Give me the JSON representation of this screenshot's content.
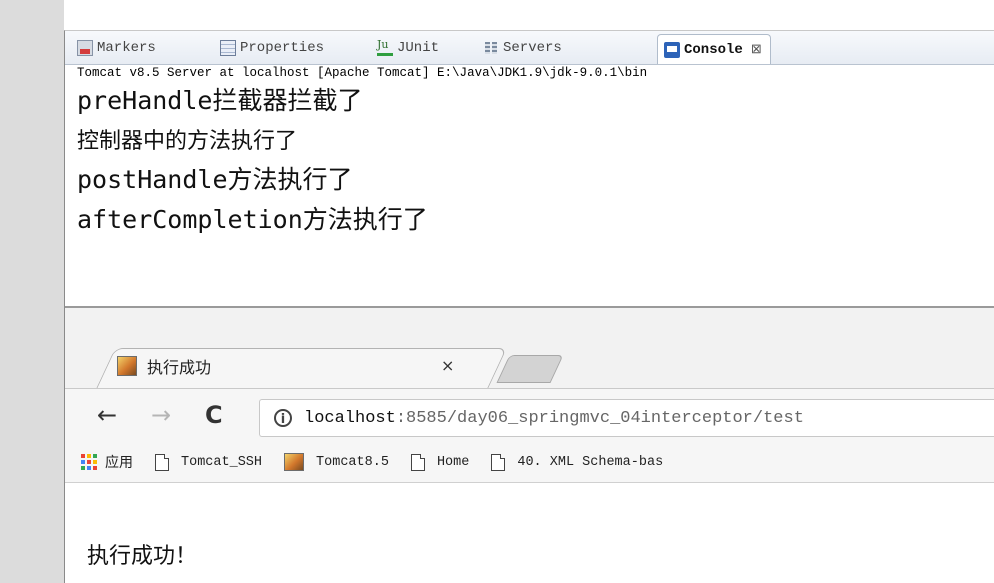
{
  "eclipse": {
    "tabs": [
      {
        "label": "Markers",
        "icon": "markers-icon"
      },
      {
        "label": "Properties",
        "icon": "properties-icon"
      },
      {
        "label": "JUnit",
        "icon": "junit-icon"
      },
      {
        "label": "Servers",
        "icon": "servers-icon"
      },
      {
        "label": "Console",
        "icon": "console-icon",
        "active": true,
        "close": "⊠"
      }
    ],
    "server_line": "Tomcat v8.5 Server at localhost [Apache Tomcat] E:\\Java\\JDK1.9\\jdk-9.0.1\\bin",
    "console_lines": [
      "preHandle拦截器拦截了",
      "控制器中的方法执行了",
      "postHandle方法执行了",
      "afterCompletion方法执行了"
    ]
  },
  "browser": {
    "tab_title": "执行成功",
    "tab_close": "×",
    "nav": {
      "back": "←",
      "forward": "→",
      "reload": "C",
      "info": "i"
    },
    "url_host": "localhost",
    "url_rest": ":8585/day06_springmvc_04interceptor/test",
    "bookmarks": [
      {
        "label": "应用",
        "icon": "apps-grid-icon"
      },
      {
        "label": "Tomcat_SSH",
        "icon": "page-icon"
      },
      {
        "label": "Tomcat8.5",
        "icon": "tomcat-cat-icon"
      },
      {
        "label": "Home",
        "icon": "page-icon"
      },
      {
        "label": "40.  XML Schema-bas",
        "icon": "page-icon"
      }
    ],
    "page_text": "执行成功！"
  },
  "colors": {
    "console_icon": "#2d63b8",
    "apps_grid": [
      "#ea4335",
      "#fbbc05",
      "#34a853",
      "#4285f4"
    ]
  }
}
